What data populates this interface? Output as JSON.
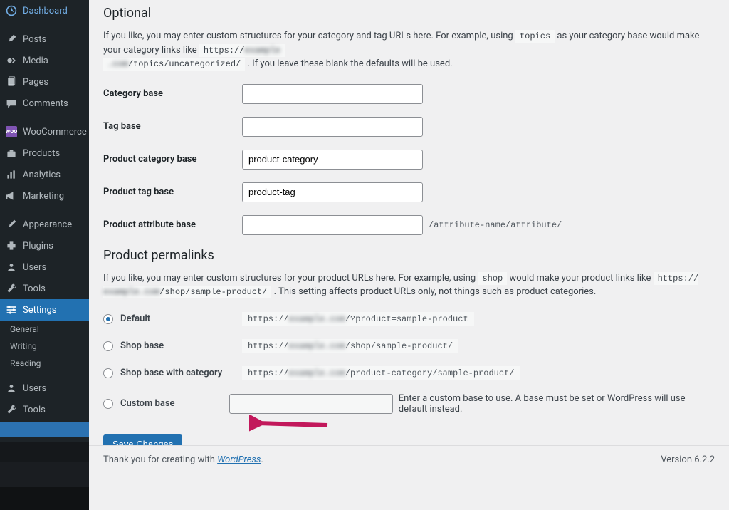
{
  "sidebar": {
    "items": [
      {
        "icon": "dashboard",
        "label": "Dashboard"
      },
      {
        "icon": "pin",
        "label": "Posts"
      },
      {
        "icon": "media",
        "label": "Media"
      },
      {
        "icon": "page",
        "label": "Pages"
      },
      {
        "icon": "comment",
        "label": "Comments"
      },
      {
        "icon": "woo",
        "label": "WooCommerce"
      },
      {
        "icon": "product",
        "label": "Products"
      },
      {
        "icon": "analytics",
        "label": "Analytics"
      },
      {
        "icon": "marketing",
        "label": "Marketing"
      },
      {
        "icon": "appearance",
        "label": "Appearance"
      },
      {
        "icon": "plugin",
        "label": "Plugins"
      },
      {
        "icon": "users",
        "label": "Users"
      },
      {
        "icon": "tools",
        "label": "Tools"
      },
      {
        "icon": "settings",
        "label": "Settings",
        "active": true
      },
      {
        "icon": "users",
        "label": "Users"
      },
      {
        "icon": "tools",
        "label": "Tools"
      }
    ],
    "subs": [
      "General",
      "Writing",
      "Reading"
    ]
  },
  "optional": {
    "heading": "Optional",
    "desc_pre": "If you like, you may enter custom structures for your category and tag URLs here. For example, using ",
    "desc_code1": "topics",
    "desc_mid": " as your category base would make your category links like ",
    "desc_code2_a": "https://",
    "desc_code2_b": "/topics/uncategorized/",
    "desc_post": " . If you leave these blank the defaults will be used.",
    "category_base": {
      "label": "Category base",
      "value": ""
    },
    "tag_base": {
      "label": "Tag base",
      "value": ""
    },
    "product_cat": {
      "label": "Product category base",
      "value": "product-category"
    },
    "product_tag": {
      "label": "Product tag base",
      "value": "product-tag"
    },
    "product_attr": {
      "label": "Product attribute base",
      "value": "",
      "after": "/attribute-name/attribute/"
    }
  },
  "permalinks": {
    "heading": "Product permalinks",
    "desc_pre": "If you like, you may enter custom structures for your product URLs here. For example, using ",
    "desc_code1": "shop",
    "desc_mid": " would make your product links like ",
    "desc_code2_a": "https://",
    "desc_code2_b": "/shop/sample-product/",
    "desc_post": " . This setting affects product URLs only, not things such as product categories.",
    "options": [
      {
        "label": "Default",
        "code_a": "https://",
        "code_b": "/?product=sample-product",
        "checked": true
      },
      {
        "label": "Shop base",
        "code_a": "https://",
        "code_b": "/shop/sample-product/",
        "checked": false
      },
      {
        "label": "Shop base with category",
        "code_a": "https://",
        "code_b": "/product-category/sample-product/",
        "checked": false
      }
    ],
    "custom": {
      "label": "Custom base",
      "help": "Enter a custom base to use. A base must be set or WordPress will use default instead."
    }
  },
  "save_label": "Save Changes",
  "footer": {
    "thank_pre": "Thank you for creating with ",
    "thank_link": "WordPress",
    "thank_post": ".",
    "version": "Version 6.2.2"
  }
}
